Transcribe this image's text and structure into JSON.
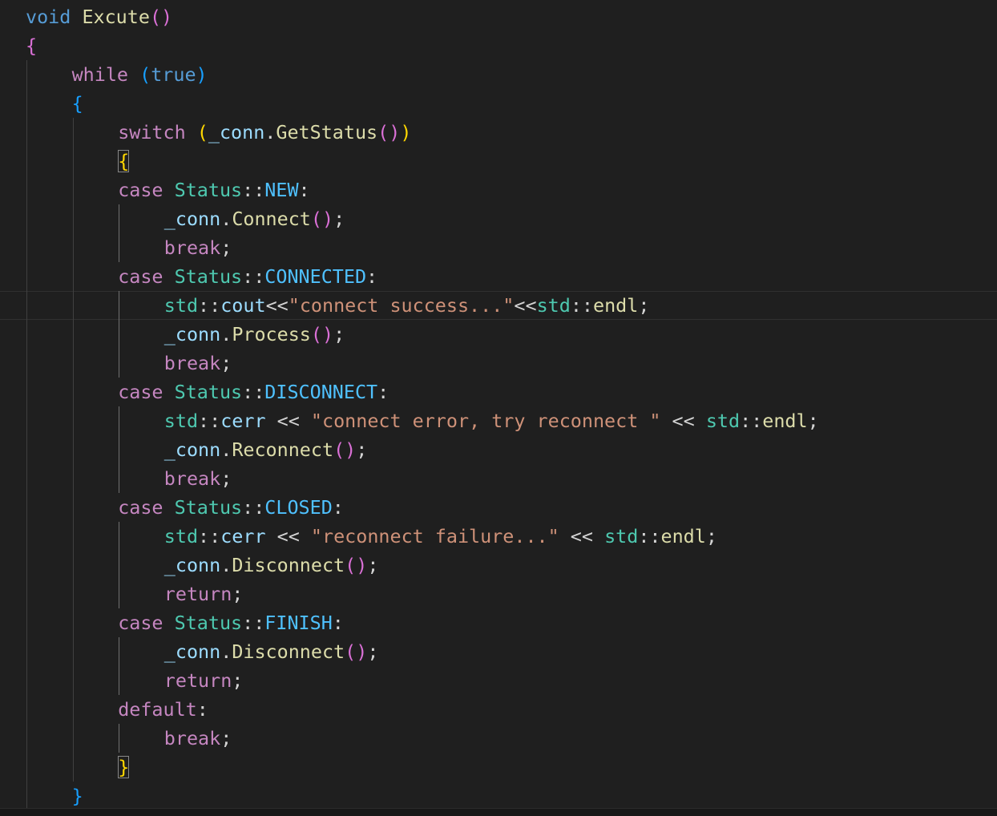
{
  "editor": {
    "background": "#1f1f1f",
    "current_line": 11,
    "colors": {
      "kw": "#569cd6",
      "ctrl": "#c586c0",
      "fn": "#dcdcaa",
      "var": "#9cdcfe",
      "type": "#4ec9b0",
      "enum": "#4fc1ff",
      "str": "#ce9178",
      "op": "#d4d4d4",
      "br1": "#ffd700",
      "br2": "#da70d6",
      "br3": "#179fff"
    },
    "lines": [
      {
        "indent": 0,
        "tokens": [
          [
            "kw",
            "void"
          ],
          [
            "op",
            " "
          ],
          [
            "fn",
            "Excute"
          ],
          [
            "br2",
            "()"
          ]
        ]
      },
      {
        "indent": 0,
        "tokens": [
          [
            "br2",
            "{"
          ]
        ]
      },
      {
        "indent": 1,
        "tokens": [
          [
            "ctrl",
            "while"
          ],
          [
            "op",
            " "
          ],
          [
            "br3",
            "("
          ],
          [
            "kw",
            "true"
          ],
          [
            "br3",
            ")"
          ]
        ]
      },
      {
        "indent": 1,
        "tokens": [
          [
            "br3",
            "{"
          ]
        ]
      },
      {
        "indent": 2,
        "tokens": [
          [
            "ctrl",
            "switch"
          ],
          [
            "op",
            " "
          ],
          [
            "br1",
            "("
          ],
          [
            "var",
            "_conn"
          ],
          [
            "op",
            "."
          ],
          [
            "fn",
            "GetStatus"
          ],
          [
            "br2",
            "()"
          ],
          [
            "br1",
            ")"
          ]
        ]
      },
      {
        "indent": 2,
        "tokens": [
          [
            "br1bm",
            "{"
          ]
        ]
      },
      {
        "indent": 2,
        "tokens": [
          [
            "ctrl",
            "case"
          ],
          [
            "op",
            " "
          ],
          [
            "type",
            "Status"
          ],
          [
            "op",
            "::"
          ],
          [
            "enum",
            "NEW"
          ],
          [
            "op",
            ":"
          ]
        ]
      },
      {
        "indent": 3,
        "tokens": [
          [
            "var",
            "_conn"
          ],
          [
            "op",
            "."
          ],
          [
            "fn",
            "Connect"
          ],
          [
            "br2",
            "()"
          ],
          [
            "op",
            ";"
          ]
        ]
      },
      {
        "indent": 3,
        "tokens": [
          [
            "ctrl",
            "break"
          ],
          [
            "op",
            ";"
          ]
        ]
      },
      {
        "indent": 2,
        "tokens": [
          [
            "ctrl",
            "case"
          ],
          [
            "op",
            " "
          ],
          [
            "type",
            "Status"
          ],
          [
            "op",
            "::"
          ],
          [
            "enum",
            "CONNECTED"
          ],
          [
            "op",
            ":"
          ]
        ]
      },
      {
        "indent": 3,
        "tokens": [
          [
            "type",
            "std"
          ],
          [
            "op",
            "::"
          ],
          [
            "var",
            "cout"
          ],
          [
            "op",
            "<<"
          ],
          [
            "str",
            "\"connect success...\""
          ],
          [
            "op",
            "<<"
          ],
          [
            "type",
            "std"
          ],
          [
            "op",
            "::"
          ],
          [
            "fn",
            "endl"
          ],
          [
            "op",
            ";"
          ]
        ]
      },
      {
        "indent": 3,
        "tokens": [
          [
            "var",
            "_conn"
          ],
          [
            "op",
            "."
          ],
          [
            "fn",
            "Process"
          ],
          [
            "br2",
            "()"
          ],
          [
            "op",
            ";"
          ]
        ]
      },
      {
        "indent": 3,
        "tokens": [
          [
            "ctrl",
            "break"
          ],
          [
            "op",
            ";"
          ]
        ]
      },
      {
        "indent": 2,
        "tokens": [
          [
            "ctrl",
            "case"
          ],
          [
            "op",
            " "
          ],
          [
            "type",
            "Status"
          ],
          [
            "op",
            "::"
          ],
          [
            "enum",
            "DISCONNECT"
          ],
          [
            "op",
            ":"
          ]
        ]
      },
      {
        "indent": 3,
        "tokens": [
          [
            "type",
            "std"
          ],
          [
            "op",
            "::"
          ],
          [
            "var",
            "cerr"
          ],
          [
            "op",
            " << "
          ],
          [
            "str",
            "\"connect error, try reconnect \""
          ],
          [
            "op",
            " << "
          ],
          [
            "type",
            "std"
          ],
          [
            "op",
            "::"
          ],
          [
            "fn",
            "endl"
          ],
          [
            "op",
            ";"
          ]
        ]
      },
      {
        "indent": 3,
        "tokens": [
          [
            "var",
            "_conn"
          ],
          [
            "op",
            "."
          ],
          [
            "fn",
            "Reconnect"
          ],
          [
            "br2",
            "()"
          ],
          [
            "op",
            ";"
          ]
        ]
      },
      {
        "indent": 3,
        "tokens": [
          [
            "ctrl",
            "break"
          ],
          [
            "op",
            ";"
          ]
        ]
      },
      {
        "indent": 2,
        "tokens": [
          [
            "ctrl",
            "case"
          ],
          [
            "op",
            " "
          ],
          [
            "type",
            "Status"
          ],
          [
            "op",
            "::"
          ],
          [
            "enum",
            "CLOSED"
          ],
          [
            "op",
            ":"
          ]
        ]
      },
      {
        "indent": 3,
        "tokens": [
          [
            "type",
            "std"
          ],
          [
            "op",
            "::"
          ],
          [
            "var",
            "cerr"
          ],
          [
            "op",
            " << "
          ],
          [
            "str",
            "\"reconnect failure...\""
          ],
          [
            "op",
            " << "
          ],
          [
            "type",
            "std"
          ],
          [
            "op",
            "::"
          ],
          [
            "fn",
            "endl"
          ],
          [
            "op",
            ";"
          ]
        ]
      },
      {
        "indent": 3,
        "tokens": [
          [
            "var",
            "_conn"
          ],
          [
            "op",
            "."
          ],
          [
            "fn",
            "Disconnect"
          ],
          [
            "br2",
            "()"
          ],
          [
            "op",
            ";"
          ]
        ]
      },
      {
        "indent": 3,
        "tokens": [
          [
            "ctrl",
            "return"
          ],
          [
            "op",
            ";"
          ]
        ]
      },
      {
        "indent": 2,
        "tokens": [
          [
            "ctrl",
            "case"
          ],
          [
            "op",
            " "
          ],
          [
            "type",
            "Status"
          ],
          [
            "op",
            "::"
          ],
          [
            "enum",
            "FINISH"
          ],
          [
            "op",
            ":"
          ]
        ]
      },
      {
        "indent": 3,
        "tokens": [
          [
            "var",
            "_conn"
          ],
          [
            "op",
            "."
          ],
          [
            "fn",
            "Disconnect"
          ],
          [
            "br2",
            "()"
          ],
          [
            "op",
            ";"
          ]
        ]
      },
      {
        "indent": 3,
        "tokens": [
          [
            "ctrl",
            "return"
          ],
          [
            "op",
            ";"
          ]
        ]
      },
      {
        "indent": 2,
        "tokens": [
          [
            "ctrl",
            "default"
          ],
          [
            "op",
            ":"
          ]
        ]
      },
      {
        "indent": 3,
        "tokens": [
          [
            "ctrl",
            "break"
          ],
          [
            "op",
            ";"
          ]
        ]
      },
      {
        "indent": 2,
        "tokens": [
          [
            "br1bm",
            "}"
          ]
        ]
      },
      {
        "indent": 1,
        "tokens": [
          [
            "br3",
            "}"
          ]
        ]
      }
    ]
  }
}
